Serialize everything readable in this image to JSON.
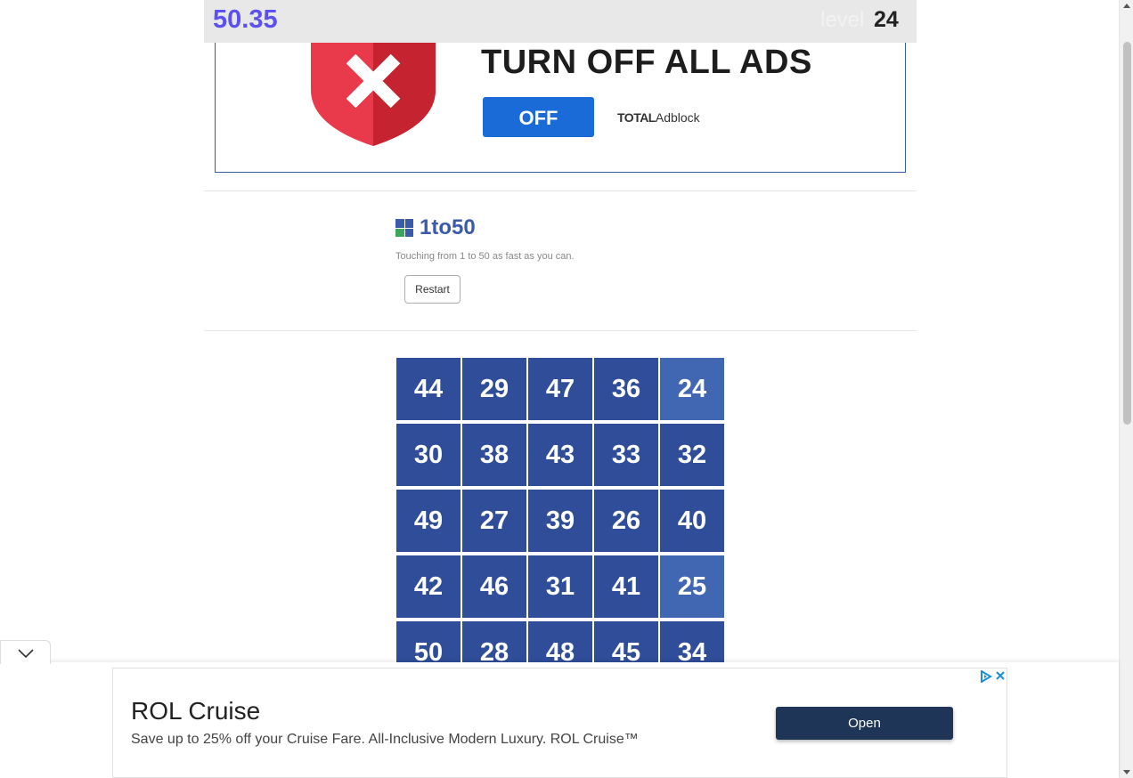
{
  "status": {
    "timer": "50.35",
    "level_label": "level",
    "level_value": "24"
  },
  "ad_banner": {
    "headline": "TURN OFF ALL ADS",
    "button_label": "OFF",
    "brand_bold": "TOTAL",
    "brand_rest": "Adblock",
    "shield_icon": "shield-x-icon",
    "colors": {
      "shield": "#d9293a",
      "button": "#1a6bd8"
    }
  },
  "game": {
    "icon": "grid-app-icon",
    "title": "1to50",
    "subtitle": "Touching from 1 to 50 as fast as you can.",
    "restart_label": "Restart"
  },
  "board": {
    "colors": {
      "tile": "#2f4d99",
      "tile_light": "#4267b2"
    },
    "rows": [
      [
        {
          "n": "44"
        },
        {
          "n": "29"
        },
        {
          "n": "47"
        },
        {
          "n": "36"
        },
        {
          "n": "24",
          "light": true
        }
      ],
      [
        {
          "n": "30"
        },
        {
          "n": "38"
        },
        {
          "n": "43"
        },
        {
          "n": "33"
        },
        {
          "n": "32"
        }
      ],
      [
        {
          "n": "49"
        },
        {
          "n": "27"
        },
        {
          "n": "39"
        },
        {
          "n": "26"
        },
        {
          "n": "40"
        }
      ],
      [
        {
          "n": "42"
        },
        {
          "n": "46"
        },
        {
          "n": "31"
        },
        {
          "n": "41"
        },
        {
          "n": "25",
          "light": true
        }
      ],
      [
        {
          "n": "50"
        },
        {
          "n": "28"
        },
        {
          "n": "48"
        },
        {
          "n": "45"
        },
        {
          "n": "34"
        }
      ]
    ]
  },
  "bottom_ad": {
    "title": "ROL Cruise",
    "description": "Save up to 25% off your Cruise Fare. All-Inclusive Modern Luxury. ROL Cruise™",
    "button_label": "Open",
    "adchoices_icon": "adchoices-icon",
    "close_icon": "close-icon",
    "collapse_icon": "chevron-down-icon"
  }
}
